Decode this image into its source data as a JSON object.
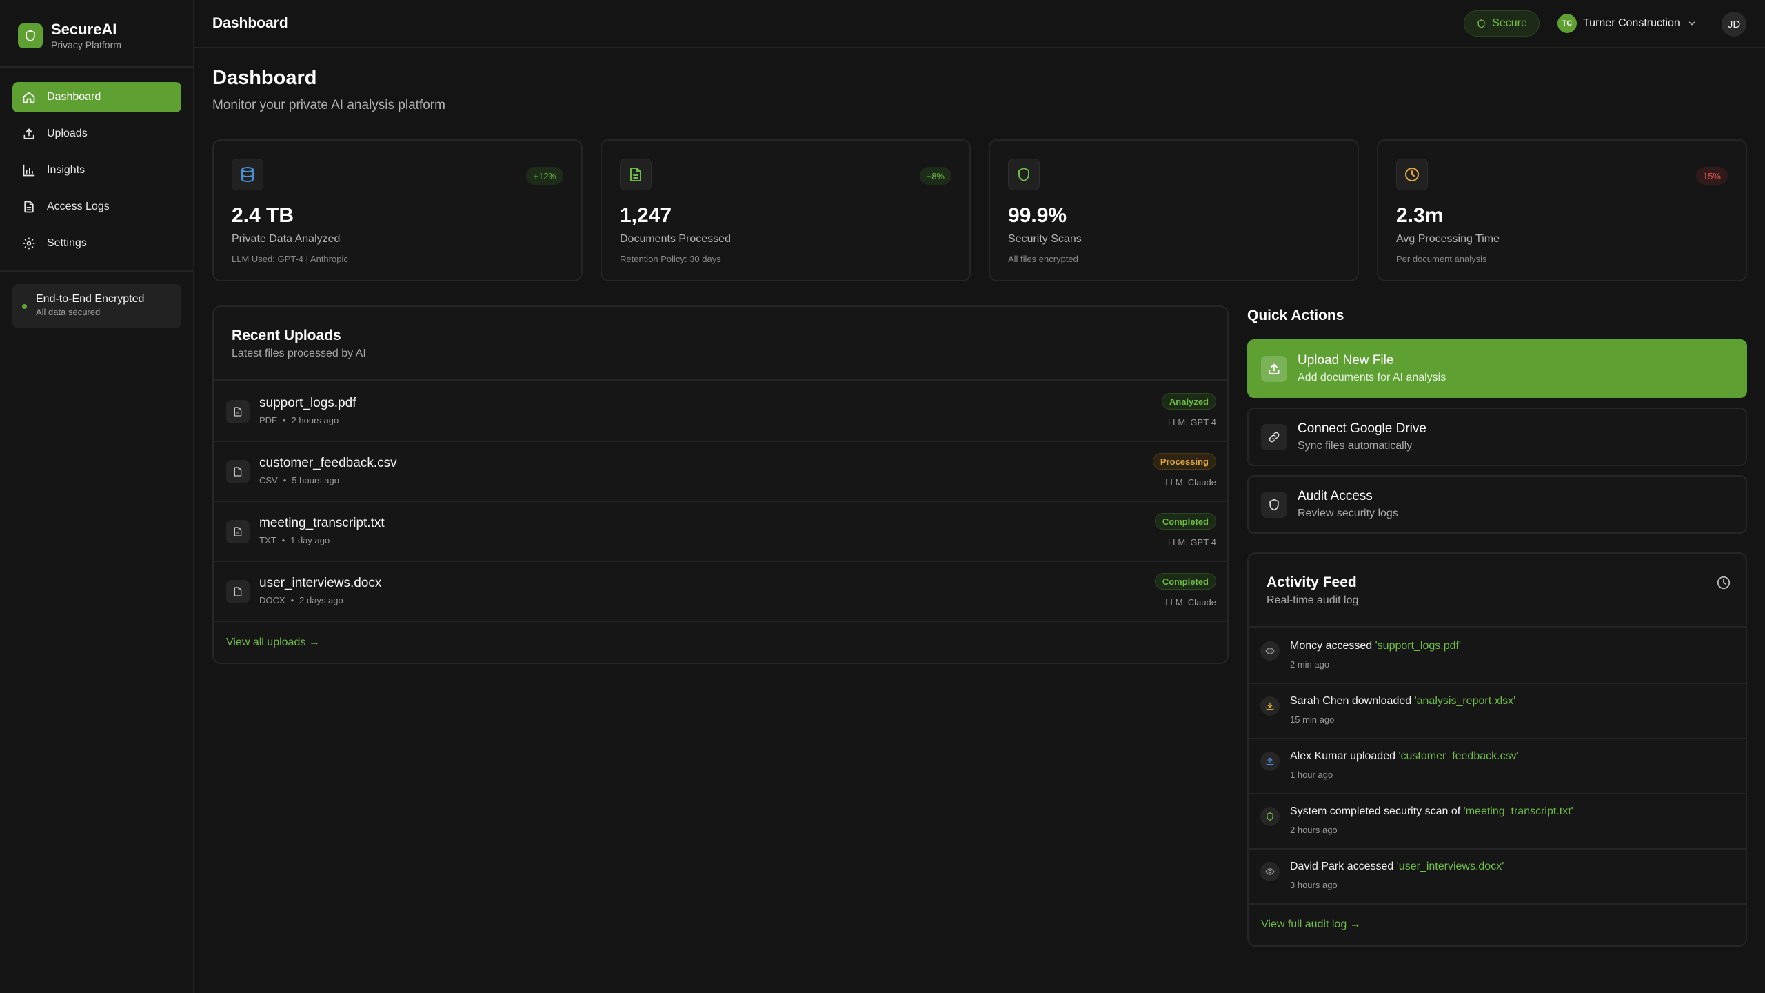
{
  "brand": {
    "name": "SecureAI",
    "subtitle": "Privacy Platform"
  },
  "sidebar": {
    "items": [
      {
        "label": "Dashboard",
        "icon": "home-icon",
        "active": true
      },
      {
        "label": "Uploads",
        "icon": "upload-icon"
      },
      {
        "label": "Insights",
        "icon": "bar-chart-icon"
      },
      {
        "label": "Access Logs",
        "icon": "document-icon"
      },
      {
        "label": "Settings",
        "icon": "gear-icon"
      }
    ],
    "encryption": {
      "title": "End-to-End Encrypted",
      "subtitle": "All data secured"
    }
  },
  "header": {
    "title": "Dashboard",
    "secure_badge": "Secure",
    "org": {
      "initials": "TC",
      "name": "Turner Construction"
    },
    "user_initials": "JD"
  },
  "page": {
    "title": "Dashboard",
    "subtitle": "Monitor your private AI analysis platform"
  },
  "stats": [
    {
      "value": "2.4 TB",
      "label": "Private Data Analyzed",
      "note": "LLM Used: GPT-4 | Anthropic",
      "delta": "+12%",
      "trend": "up",
      "icon": "database-icon",
      "icon_color": "#4a90d9"
    },
    {
      "value": "1,247",
      "label": "Documents Processed",
      "note": "Retention Policy: 30 days",
      "delta": "+8%",
      "trend": "up",
      "icon": "file-text-icon",
      "icon_color": "#6fbd46"
    },
    {
      "value": "99.9%",
      "label": "Security Scans",
      "note": "All files encrypted",
      "delta": "",
      "trend": "none",
      "icon": "shield-icon",
      "icon_color": "#6fbd46"
    },
    {
      "value": "2.3m",
      "label": "Avg Processing Time",
      "note": "Per document analysis",
      "delta": "15%",
      "trend": "down",
      "icon": "clock-icon",
      "icon_color": "#e0a640"
    }
  ],
  "uploads": {
    "title": "Recent Uploads",
    "subtitle": "Latest files processed by AI",
    "files": [
      {
        "name": "support_logs.pdf",
        "type": "PDF",
        "time": "2 hours ago",
        "status": "Analyzed",
        "status_color": "green",
        "llm": "LLM: GPT-4"
      },
      {
        "name": "customer_feedback.csv",
        "type": "CSV",
        "time": "5 hours ago",
        "status": "Processing",
        "status_color": "amber",
        "llm": "LLM: Claude"
      },
      {
        "name": "meeting_transcript.txt",
        "type": "TXT",
        "time": "1 day ago",
        "status": "Completed",
        "status_color": "green",
        "llm": "LLM: GPT-4"
      },
      {
        "name": "user_interviews.docx",
        "type": "DOCX",
        "time": "2 days ago",
        "status": "Completed",
        "status_color": "green",
        "llm": "LLM: Claude"
      }
    ],
    "view_all": "View all uploads →"
  },
  "quick_actions": {
    "title": "Quick Actions",
    "items": [
      {
        "name": "Upload New File",
        "desc": "Add documents for AI analysis",
        "icon": "upload-icon",
        "primary": true
      },
      {
        "name": "Connect Google Drive",
        "desc": "Sync files automatically",
        "icon": "link-icon"
      },
      {
        "name": "Audit Access",
        "desc": "Review security logs",
        "icon": "shield-icon"
      }
    ]
  },
  "activity": {
    "title": "Activity Feed",
    "subtitle": "Real-time audit log",
    "items": [
      {
        "text": "Moncy accessed ",
        "file": "'support_logs.pdf'",
        "time": "2 min ago",
        "icon": "eye-icon",
        "icon_color": "#9a9a9a"
      },
      {
        "text": "Sarah Chen downloaded ",
        "file": "'analysis_report.xlsx'",
        "time": "15 min ago",
        "icon": "download-icon",
        "icon_color": "#e0a640"
      },
      {
        "text": "Alex Kumar uploaded ",
        "file": "'customer_feedback.csv'",
        "time": "1 hour ago",
        "icon": "upload-icon",
        "icon_color": "#4a90d9"
      },
      {
        "text": "System completed security scan of ",
        "file": "'meeting_transcript.txt'",
        "time": "2 hours ago",
        "icon": "shield-icon",
        "icon_color": "#6fbd46"
      },
      {
        "text": "David Park accessed ",
        "file": "'user_interviews.docx'",
        "time": "3 hours ago",
        "icon": "eye-icon",
        "icon_color": "#9a9a9a"
      }
    ],
    "view_all": "View full audit log →"
  }
}
